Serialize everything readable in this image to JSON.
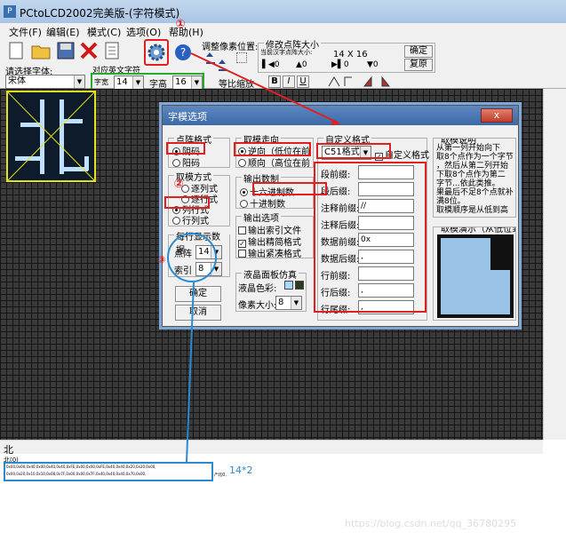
{
  "title": "PCtoLCD2002完美版-(字符模式)",
  "menu": [
    "文件(F)",
    "编辑(E)",
    "模式(C)",
    "选项(O)",
    "帮助(H)"
  ],
  "toolbar": {
    "adjust_label": "调整像素位置:",
    "size_label": "修改点阵大小",
    "current_size_note": "当前汉字点阵大小:",
    "current_size": "14 X 16",
    "confirm": "确定",
    "restore": "复原",
    "spin_values": [
      "0",
      "0",
      "0",
      "0"
    ],
    "equal_scale": "等比缩放",
    "bold": "B",
    "italic": "I",
    "underline": "U",
    "choose_font": "请选择字体:",
    "font_value": "宋体",
    "ascii_label": "对应英文字符",
    "width_label": "字宽",
    "width_value": "14",
    "height_label": "字高",
    "height_value": "16"
  },
  "dialog": {
    "title": "字模选项",
    "close": "x",
    "dot_format": {
      "title": "点阵格式",
      "options": [
        "阴码",
        "阳码"
      ],
      "selected": 0
    },
    "scan_dir": {
      "title": "取模走向",
      "options": [
        "逆向（低位在前",
        "顺向（高位在前"
      ],
      "selected": 0
    },
    "custom_format": {
      "title": "自定义格式",
      "select": "C51格式",
      "check": "自定义格式"
    },
    "explain": {
      "title": "取模说明",
      "lines": [
        "从第一列开始向下",
        "取8个点作为一个字节",
        "，然后从第二列开始",
        "下取8个点作为第二",
        "字节...依此类推。",
        "果最后不足8个点就补",
        "满8位。",
        "取模顺序是从低到高"
      ]
    },
    "mode": {
      "title": "取模方式",
      "options": [
        "逐列式",
        "逐行式",
        "列行式",
        "行列式"
      ],
      "selected": 2
    },
    "num_system": {
      "title": "输出数制",
      "options": [
        "十六进制数",
        "十进制数"
      ],
      "selected": 0
    },
    "fields": [
      {
        "label": "段前缀:",
        "value": ""
      },
      {
        "label": "段后缀:",
        "value": ""
      },
      {
        "label": "注释前缀:",
        "value": "//"
      },
      {
        "label": "注释后缀:",
        "value": ""
      },
      {
        "label": "数据前缀:",
        "value": "0x"
      },
      {
        "label": "数据后缀:",
        "value": ","
      },
      {
        "label": "行前缀:",
        "value": ""
      },
      {
        "label": "行后缀:",
        "value": ","
      },
      {
        "label": "行尾缀:",
        "value": ","
      }
    ],
    "per_line": {
      "title": "每行显示数据",
      "dot_label": "点阵",
      "dot_value": "14",
      "index_label": "索引",
      "index_value": "8"
    },
    "output_opts": {
      "title": "输出选项",
      "items": [
        {
          "label": "输出索引文件",
          "checked": false
        },
        {
          "label": "输出精简格式",
          "checked": true
        },
        {
          "label": "输出紧凑格式",
          "checked": false
        }
      ]
    },
    "lcd_sim": {
      "title": "液晶面板仿真",
      "color_label": "液晶色彩:",
      "pixel_label": "像素大小:",
      "pixel_value": "8"
    },
    "ok": "确定",
    "cancel": "取消",
    "demo_title": "取模演示（从低位到"
  },
  "bottom": {
    "char": "北",
    "comment": "北(0)",
    "line1": "0x00,0x00,0x40,0x40,0x40,0x40,0xFE,0x00,0x00,0xFE,0x40,0x40,0x20,0x20,0x00,",
    "line2": "0x00,0x20,0x10,0x10,0x08,0x7F,0x00,0x00,0x7F,0x40,0x40,0x40,0x70,0x00,",
    "tail": "/*北0,",
    "annotation": "14*2",
    "watermark": "https://blog.csdn.net/qq_36780295"
  },
  "annotations": {
    "one": "①",
    "two": "②",
    "three": "③"
  },
  "colors": {
    "grid": "#3a3a3a",
    "pixel": "#bfe0ff",
    "red": "#e02020",
    "yellow": "#e0e020",
    "blue": "#2a8ad0",
    "lcd_bg": "#0d1b2a",
    "lcd_fg": "#a8d8ff"
  }
}
